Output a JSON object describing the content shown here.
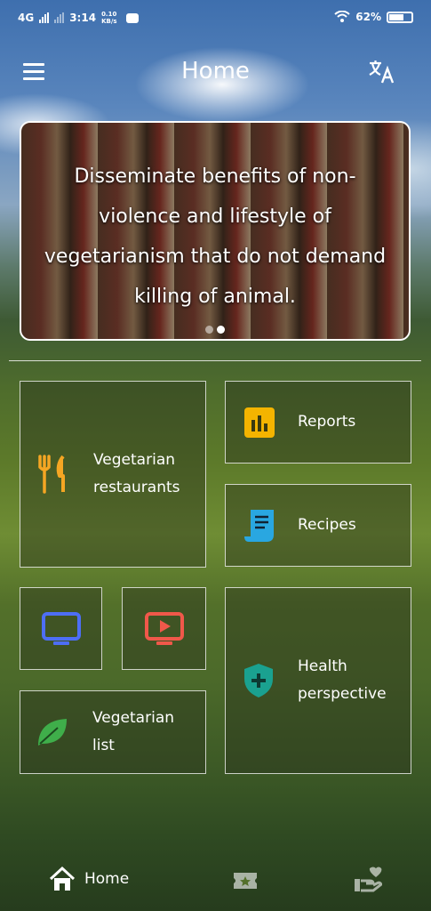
{
  "status_bar": {
    "network": "4G",
    "time": "3:14",
    "speed": "0.10 KB/s",
    "battery": "62%"
  },
  "app_bar": {
    "title": "Home"
  },
  "banner": {
    "text": "Disseminate benefits of non-violence and lifestyle of vegetarianism that do not demand killing of animal.",
    "lines": [
      "Disseminate benefits of non-",
      "violence and lifestyle of",
      "vegetarianism that do not demand",
      "killing of animal."
    ],
    "active_slide": 2,
    "slides": 2
  },
  "tiles": {
    "restaurants": {
      "line1": "Vegetarian",
      "line2": "restaurants",
      "icon": "fork-knife-icon",
      "color": "#f5a623"
    },
    "reports": {
      "label": "Reports",
      "icon": "bar-chart-icon",
      "color": "#f4b400"
    },
    "recipes": {
      "label": "Recipes",
      "icon": "receipt-icon",
      "color": "#29a7e1"
    },
    "tv": {
      "icon": "tv-icon",
      "color": "#4d6ef5"
    },
    "video": {
      "icon": "video-play-icon",
      "color": "#f0584a"
    },
    "health": {
      "line1": "Health",
      "line2": "perspective",
      "icon": "shield-plus-icon",
      "color": "#1aa190"
    },
    "veg_list": {
      "line1": "Vegetarian",
      "line2": "list",
      "icon": "leaf-icon",
      "color": "#3fae4a"
    }
  },
  "bottom_nav": {
    "home_label": "Home",
    "items": [
      "home-icon",
      "ticket-icon",
      "hand-heart-icon"
    ]
  }
}
